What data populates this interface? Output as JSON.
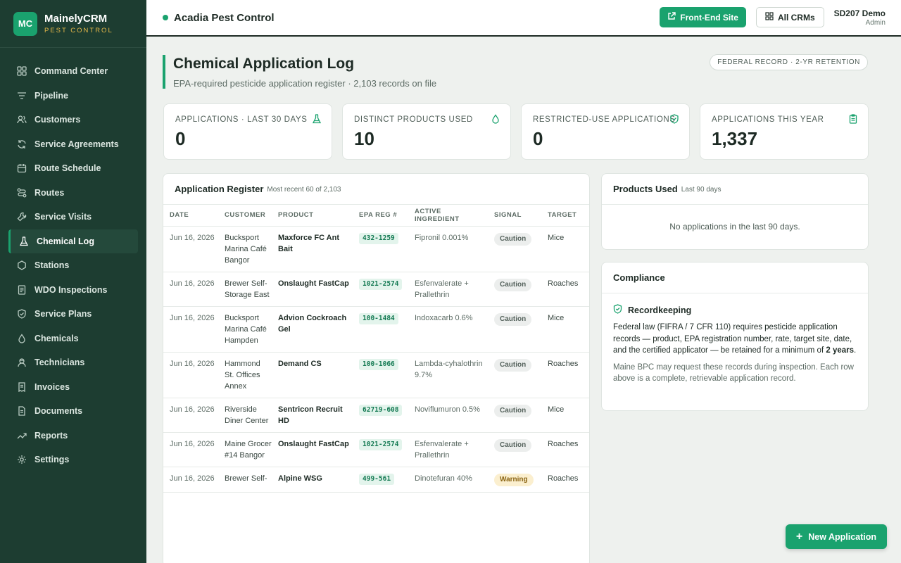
{
  "brand": {
    "initials": "MC",
    "name": "MainelyCRM",
    "sub": "PEST CONTROL"
  },
  "nav": [
    {
      "label": "Command Center",
      "icon": "grid-icon"
    },
    {
      "label": "Pipeline",
      "icon": "filter-icon"
    },
    {
      "label": "Customers",
      "icon": "users-icon"
    },
    {
      "label": "Service Agreements",
      "icon": "refresh-icon"
    },
    {
      "label": "Route Schedule",
      "icon": "calendar-icon"
    },
    {
      "label": "Routes",
      "icon": "route-icon"
    },
    {
      "label": "Service Visits",
      "icon": "wrench-icon"
    },
    {
      "label": "Chemical Log",
      "icon": "flask-icon",
      "active": true
    },
    {
      "label": "Stations",
      "icon": "hexagon-icon"
    },
    {
      "label": "WDO Inspections",
      "icon": "document-icon"
    },
    {
      "label": "Service Plans",
      "icon": "shield-icon"
    },
    {
      "label": "Chemicals",
      "icon": "droplet-icon"
    },
    {
      "label": "Technicians",
      "icon": "technician-icon"
    },
    {
      "label": "Invoices",
      "icon": "invoice-icon"
    },
    {
      "label": "Documents",
      "icon": "file-icon"
    },
    {
      "label": "Reports",
      "icon": "trend-icon"
    },
    {
      "label": "Settings",
      "icon": "gear-icon"
    }
  ],
  "topbar": {
    "org": "Acadia Pest Control",
    "front_end": "Front-End Site",
    "all_crms": "All CRMs",
    "user_name": "SD207 Demo",
    "user_role": "Admin"
  },
  "page": {
    "title": "Chemical Application Log",
    "subtitle": "EPA-required pesticide application register · 2,103 records on file",
    "retention": "FEDERAL RECORD · 2-YR RETENTION"
  },
  "stats": [
    {
      "label": "APPLICATIONS · LAST 30 DAYS",
      "value": "0",
      "icon": "flask-icon"
    },
    {
      "label": "DISTINCT PRODUCTS USED",
      "value": "10",
      "icon": "droplet-icon"
    },
    {
      "label": "RESTRICTED-USE APPLICATIONS",
      "value": "0",
      "icon": "shield-icon"
    },
    {
      "label": "APPLICATIONS THIS YEAR",
      "value": "1,337",
      "icon": "clipboard-icon"
    }
  ],
  "register": {
    "title": "Application Register",
    "meta": "Most recent 60 of 2,103",
    "columns": [
      "DATE",
      "CUSTOMER",
      "PRODUCT",
      "EPA REG #",
      "ACTIVE INGREDIENT",
      "SIGNAL",
      "TARGET"
    ],
    "rows": [
      {
        "date": "Jun 16, 2026",
        "customer": "Bucksport Marina Café Bangor",
        "product": "Maxforce FC Ant Bait",
        "epa": "432-1259",
        "ingredient": "Fipronil 0.001%",
        "signal": "Caution",
        "target": "Mice"
      },
      {
        "date": "Jun 16, 2026",
        "customer": "Brewer Self-Storage East",
        "product": "Onslaught FastCap",
        "epa": "1021-2574",
        "ingredient": "Esfenvalerate + Prallethrin",
        "signal": "Caution",
        "target": "Roaches"
      },
      {
        "date": "Jun 16, 2026",
        "customer": "Bucksport Marina Café Hampden",
        "product": "Advion Cockroach Gel",
        "epa": "100-1484",
        "ingredient": "Indoxacarb 0.6%",
        "signal": "Caution",
        "target": "Mice"
      },
      {
        "date": "Jun 16, 2026",
        "customer": "Hammond St. Offices Annex",
        "product": "Demand CS",
        "epa": "100-1066",
        "ingredient": "Lambda-cyhalothrin 9.7%",
        "signal": "Caution",
        "target": "Roaches"
      },
      {
        "date": "Jun 16, 2026",
        "customer": "Riverside Diner Center",
        "product": "Sentricon Recruit HD",
        "epa": "62719-608",
        "ingredient": "Noviflumuron 0.5%",
        "signal": "Caution",
        "target": "Mice"
      },
      {
        "date": "Jun 16, 2026",
        "customer": "Maine Grocer #14 Bangor",
        "product": "Onslaught FastCap",
        "epa": "1021-2574",
        "ingredient": "Esfenvalerate + Prallethrin",
        "signal": "Caution",
        "target": "Roaches"
      },
      {
        "date": "Jun 16, 2026",
        "customer": "Brewer Self-",
        "product": "Alpine WSG",
        "epa": "499-561",
        "ingredient": "Dinotefuran 40%",
        "signal": "Warning",
        "target": "Roaches"
      }
    ]
  },
  "products_used": {
    "title": "Products Used",
    "meta": "Last 90 days",
    "empty": "No applications in the last 90 days."
  },
  "compliance": {
    "title": "Compliance",
    "sub": "Recordkeeping",
    "text_before": "Federal law (FIFRA / 7 CFR 110) requires pesticide application records — product, EPA registration number, rate, target site, date, and the certified applicator — be retained for a minimum of ",
    "text_bold": "2 years",
    "text_after": ".",
    "note": "Maine BPC may request these records during inspection. Each row above is a complete, retrievable application record."
  },
  "fab": {
    "label": "New Application"
  }
}
